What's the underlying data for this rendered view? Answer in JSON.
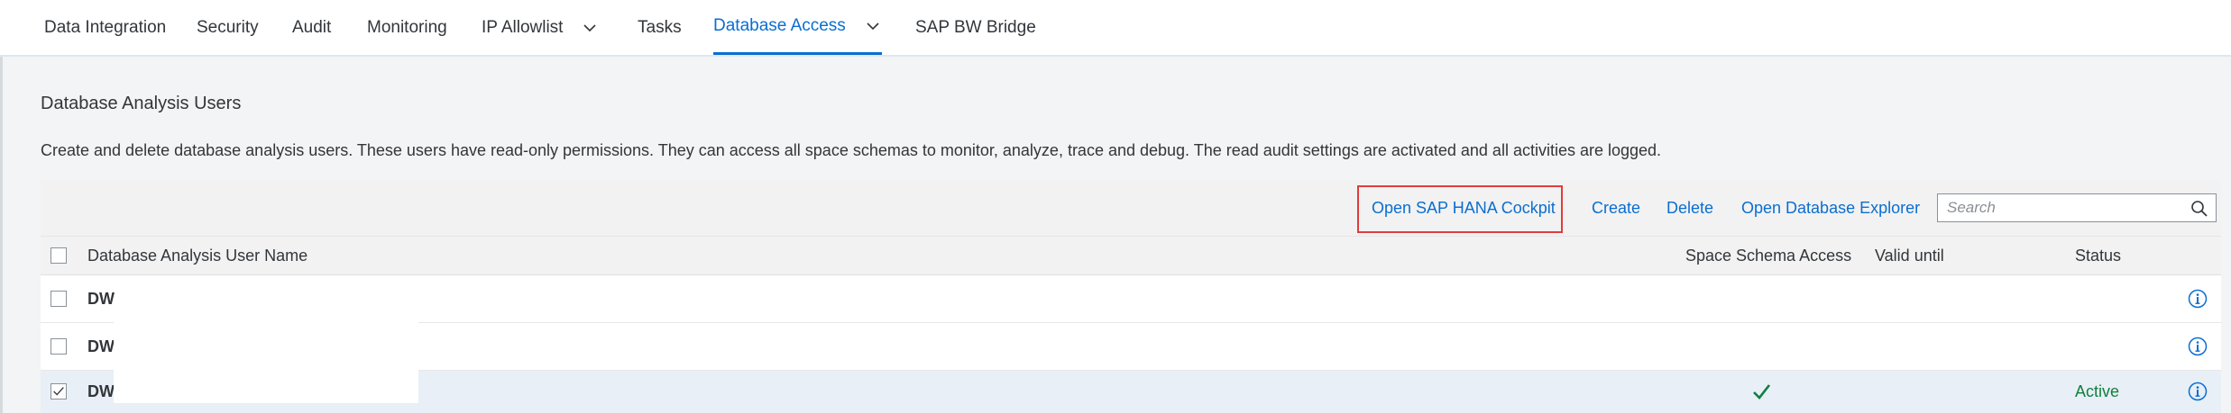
{
  "tabs": [
    {
      "label": "Data Integration",
      "active": false,
      "has_dropdown": false
    },
    {
      "label": "Security",
      "active": false,
      "has_dropdown": false
    },
    {
      "label": "Audit",
      "active": false,
      "has_dropdown": false
    },
    {
      "label": "Monitoring",
      "active": false,
      "has_dropdown": false
    },
    {
      "label": "IP Allowlist",
      "active": false,
      "has_dropdown": true
    },
    {
      "label": "Tasks",
      "active": false,
      "has_dropdown": false
    },
    {
      "label": "Database Access",
      "active": true,
      "has_dropdown": true
    },
    {
      "label": "SAP BW Bridge",
      "active": false,
      "has_dropdown": false
    }
  ],
  "section": {
    "title": "Database Analysis Users",
    "description": "Create and delete database analysis users. These users have read-only permissions. They can access all space schemas to monitor, analyze, trace and debug. The read audit settings are activated and all activities are logged."
  },
  "toolbar": {
    "open_cockpit_label": "Open SAP HANA Cockpit",
    "create_label": "Create",
    "delete_label": "Delete",
    "open_explorer_label": "Open Database Explorer",
    "search_placeholder": "Search",
    "search_value": ""
  },
  "table": {
    "columns": {
      "name": "Database Analysis User Name",
      "space_schema_access": "Space Schema Access",
      "valid_until": "Valid until",
      "status": "Status"
    },
    "rows": [
      {
        "name": "DW",
        "checked": false,
        "space_schema_access": false,
        "valid_until": "",
        "status": ""
      },
      {
        "name": "DW",
        "checked": false,
        "space_schema_access": false,
        "valid_until": "",
        "status": ""
      },
      {
        "name": "DW",
        "checked": true,
        "space_schema_access": true,
        "valid_until": "",
        "status": "Active"
      }
    ]
  },
  "colors": {
    "accent": "#0a6ed1",
    "highlight_box": "#e03c3c",
    "status_positive": "#107e3e",
    "selected_row": "#e8eff6"
  },
  "icons": {
    "dropdown": "chevron-down-icon",
    "search": "search-icon",
    "info": "info-icon",
    "checkmark": "checkmark-icon",
    "checkbox": "checkbox-icon"
  }
}
